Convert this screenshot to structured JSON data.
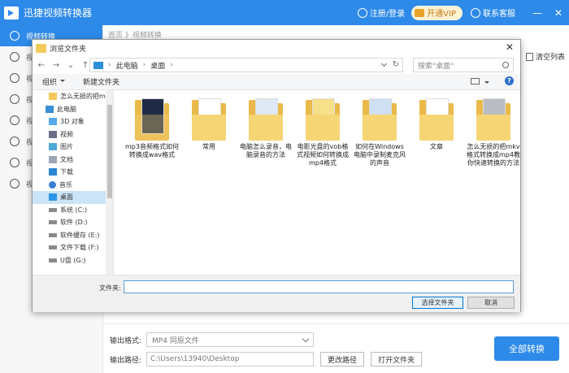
{
  "app": {
    "title": "迅捷视频转换器",
    "login": "注册/登录",
    "vip": "开通VIP",
    "service": "联系客服",
    "minimize": "—",
    "close": "✕"
  },
  "sidebar": {
    "items": [
      {
        "label": "视频转换",
        "icon": "video-convert-icon"
      },
      {
        "label": "视",
        "icon": "video-split-icon"
      },
      {
        "label": "视",
        "icon": "video-merge-icon"
      },
      {
        "label": "视",
        "icon": "video-compress-icon"
      },
      {
        "label": "视",
        "icon": "video-edit-icon"
      },
      {
        "label": "视",
        "icon": "video-image-icon"
      },
      {
        "label": "视",
        "icon": "video-audio-icon"
      },
      {
        "label": "视",
        "icon": "video-more-icon"
      }
    ]
  },
  "main": {
    "breadcrumb": "首页 》视频转换",
    "clear_list": "清空列表"
  },
  "bottom": {
    "format_label": "输出格式:",
    "format_value": "MP4  同原文件",
    "path_label": "输出路径:",
    "path_value": "C:\\Users\\13940\\Desktop",
    "change_path": "更改路径",
    "open_folder": "打开文件夹",
    "convert_all": "全部转换"
  },
  "dialog": {
    "title": "浏览文件夹",
    "close": "✕",
    "nav": {
      "back": "←",
      "forward": "→",
      "down": "⌄",
      "up": "↑"
    },
    "address": [
      "此电脑",
      "桌面"
    ],
    "search_placeholder": "搜索\"桌面\"",
    "organize": "组织",
    "new_folder": "新建文件夹",
    "help": "?",
    "tree": [
      {
        "label": "怎么无损的把ml",
        "icon": "folder"
      },
      {
        "label": "此电脑",
        "icon": "pc"
      },
      {
        "label": "3D 对象",
        "icon": "3d"
      },
      {
        "label": "视频",
        "icon": "video"
      },
      {
        "label": "图片",
        "icon": "pic"
      },
      {
        "label": "文档",
        "icon": "doc"
      },
      {
        "label": "下载",
        "icon": "down"
      },
      {
        "label": "音乐",
        "icon": "music"
      },
      {
        "label": "桌面",
        "icon": "desk"
      },
      {
        "label": "系统 (C:)",
        "icon": "drive"
      },
      {
        "label": "软件 (D:)",
        "icon": "drive"
      },
      {
        "label": "软件缓存 (E:)",
        "icon": "drive"
      },
      {
        "label": "文件下载 (F:)",
        "icon": "drive"
      },
      {
        "label": "U盘 (G:)",
        "icon": "drive"
      }
    ],
    "files": [
      {
        "name": "mp3音频格式如何转换成wav格式"
      },
      {
        "name": "常用"
      },
      {
        "name": "电脑怎么录音，电脑录音的方法"
      },
      {
        "name": "电影光盘的vob格式视频如何转换成mp4格式"
      },
      {
        "name": "如何在Windows电脑中录制麦克风的声音"
      },
      {
        "name": "文章"
      },
      {
        "name": "怎么无损的把mkv格式转换成mp4教你快速转换的方法"
      }
    ],
    "filename_label": "文件夹:",
    "filename_value": "",
    "select_button": "选择文件夹",
    "cancel_button": "取消"
  }
}
